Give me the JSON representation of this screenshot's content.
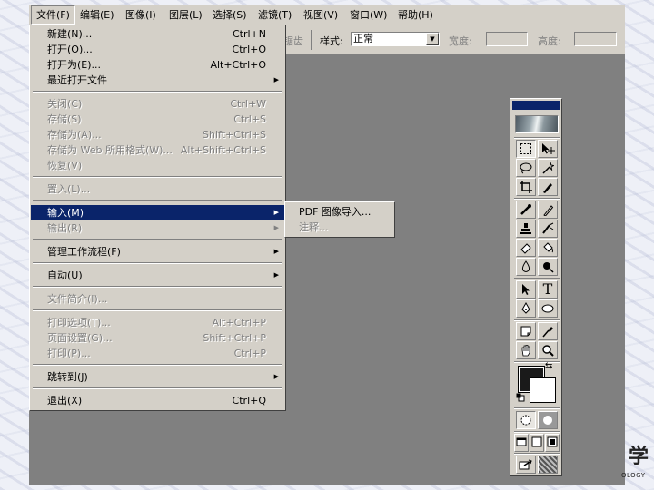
{
  "menubar": {
    "items": [
      {
        "label": "文件(F)"
      },
      {
        "label": "编辑(E)"
      },
      {
        "label": "图像(I)"
      },
      {
        "label": "图层(L)"
      },
      {
        "label": "选择(S)"
      },
      {
        "label": "滤镜(T)"
      },
      {
        "label": "视图(V)"
      },
      {
        "label": "窗口(W)"
      },
      {
        "label": "帮助(H)"
      }
    ]
  },
  "options_bar": {
    "antialias_partial": "锯齿",
    "style_label": "样式:",
    "style_value": "正常",
    "width_label": "宽度:",
    "height_label": "高度:"
  },
  "file_menu": {
    "new": {
      "label": "新建(N)...",
      "shortcut": "Ctrl+N"
    },
    "open": {
      "label": "打开(O)...",
      "shortcut": "Ctrl+O"
    },
    "open_as": {
      "label": "打开为(E)...",
      "shortcut": "Alt+Ctrl+O"
    },
    "recent": {
      "label": "最近打开文件"
    },
    "close": {
      "label": "关闭(C)",
      "shortcut": "Ctrl+W"
    },
    "save": {
      "label": "存储(S)",
      "shortcut": "Ctrl+S"
    },
    "save_as": {
      "label": "存储为(A)...",
      "shortcut": "Shift+Ctrl+S"
    },
    "save_web": {
      "label": "存储为 Web 所用格式(W)...",
      "shortcut": "Alt+Shift+Ctrl+S"
    },
    "revert": {
      "label": "恢复(V)"
    },
    "place": {
      "label": "置入(L)..."
    },
    "import": {
      "label": "输入(M)"
    },
    "export": {
      "label": "输出(R)"
    },
    "workflow": {
      "label": "管理工作流程(F)"
    },
    "automate": {
      "label": "自动(U)"
    },
    "file_info": {
      "label": "文件简介(I)..."
    },
    "print_options": {
      "label": "打印选项(T)...",
      "shortcut": "Alt+Ctrl+P"
    },
    "page_setup": {
      "label": "页面设置(G)...",
      "shortcut": "Shift+Ctrl+P"
    },
    "print": {
      "label": "打印(P)...",
      "shortcut": "Ctrl+P"
    },
    "jump_to": {
      "label": "跳转到(J)"
    },
    "exit": {
      "label": "退出(X)",
      "shortcut": "Ctrl+Q"
    }
  },
  "import_submenu": {
    "pdf_image": "PDF 图像导入...",
    "annotations": "注释..."
  },
  "toolbox": {
    "type_tool_glyph": "T"
  },
  "corner_logo": {
    "glyph": "学",
    "text": "OLOGY"
  }
}
